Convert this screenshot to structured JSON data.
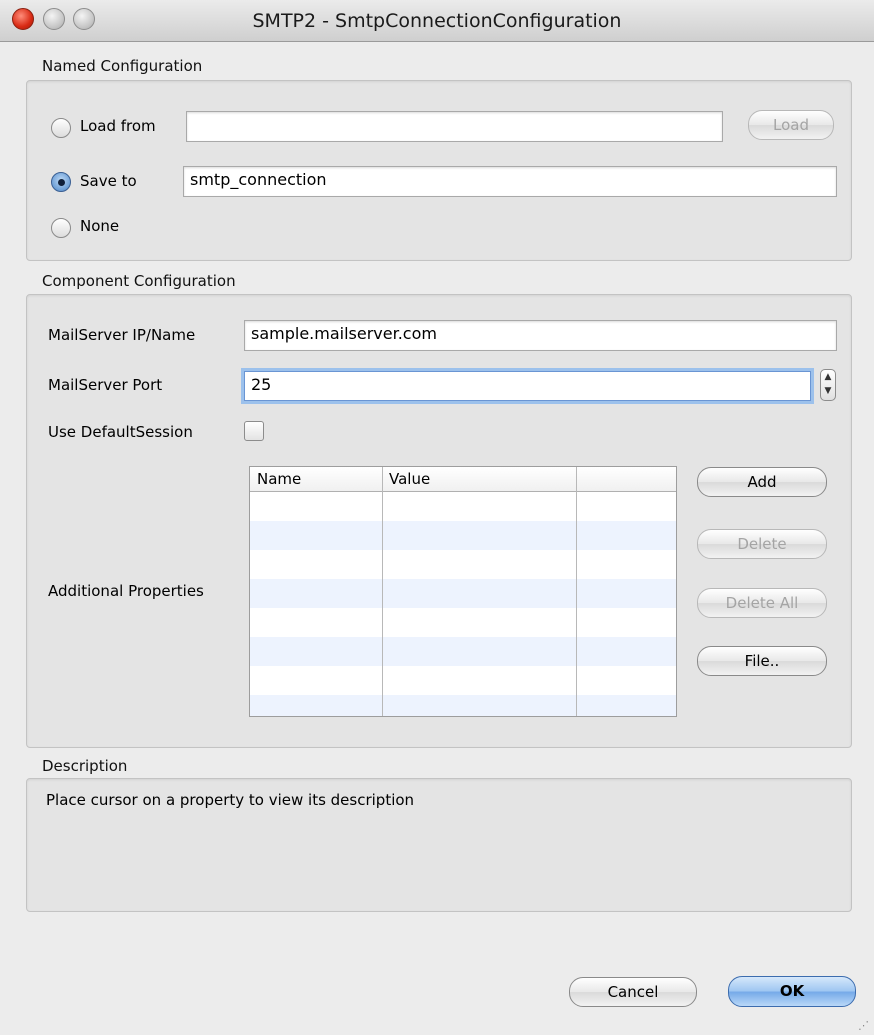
{
  "window": {
    "title": "SMTP2 - SmtpConnectionConfiguration"
  },
  "named_config": {
    "section_label": "Named Configuration",
    "load_from_label": "Load from",
    "load_from_value": "",
    "load_button": "Load",
    "save_to_label": "Save to",
    "save_to_value": "smtp_connection",
    "none_label": "None",
    "selected": "Save to"
  },
  "component_config": {
    "section_label": "Component Configuration",
    "mailserver_label": "MailServer IP/Name",
    "mailserver_value": "sample.mailserver.com",
    "port_label": "MailServer Port",
    "port_value": "25",
    "default_session_label": "Use DefaultSession",
    "default_session_checked": false,
    "additional_label": "Additional Properties",
    "table_columns": [
      "Name",
      "Value",
      ""
    ],
    "table_rows": [],
    "buttons": {
      "add": "Add",
      "delete": "Delete",
      "delete_all": "Delete All",
      "file": "File.."
    }
  },
  "description": {
    "section_label": "Description",
    "text": "Place cursor on a property to view its description"
  },
  "footer": {
    "cancel": "Cancel",
    "ok": "OK"
  },
  "colors": {
    "accent": "#6a95d3",
    "row_alt": "#edf3fe",
    "close_light": "#d82a14"
  }
}
